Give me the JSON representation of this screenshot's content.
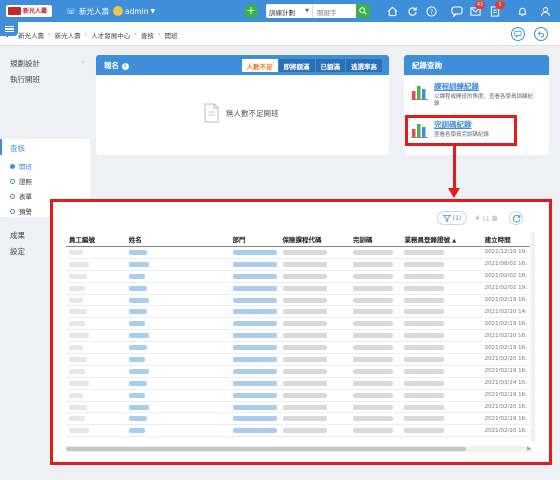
{
  "brand": {
    "logo_text": "新光人壽",
    "accent": "#3f8ed9",
    "highlight": "#e31b1b"
  },
  "topbar": {
    "company_label": "新光人壽",
    "user_label": "admin",
    "search_select_value": "訓練計劃",
    "search_placeholder": "關鍵字",
    "badge_inbox": "42",
    "badge_tasks": "1"
  },
  "breadcrumb": [
    "新光人壽",
    "新光人壽",
    "人才發展中心",
    "查核",
    "開班"
  ],
  "sidebar": {
    "items": [
      "規劃設計",
      "執行開班",
      "查核",
      "成果",
      "設定"
    ],
    "subitems": [
      "開班",
      "證照",
      "表單",
      "預警"
    ]
  },
  "enroll_card": {
    "title": "報名",
    "tabs": [
      "人數不足",
      "即將額滿",
      "已額滿",
      "逃選率高"
    ],
    "empty_text": "無人數不足開班"
  },
  "records_card": {
    "title": "紀錄查詢",
    "items": [
      {
        "title": "課程訓練紀錄",
        "desc": "以課程或開班的角度，查看各學員訓練紀錄"
      },
      {
        "title": "完訓碼紀錄",
        "desc": "查看各學員完訓碼紀錄"
      }
    ]
  },
  "table": {
    "filter_label": "(1)",
    "count_label": "11 筆",
    "headers": [
      "員工編號",
      "姓名",
      "部門",
      "保險課程代碼",
      "完訓碼",
      "業務員登錄證號",
      "建立時間"
    ],
    "dates": [
      "2021/12/10 19:",
      "2021/08/02 16:",
      "2021/02/02 18:",
      "2021/02/02 19:",
      "2021/02/19 16:",
      "2021/02/20 14:",
      "2021/02/19 16:",
      "2021/02/20 16:",
      "2021/02/19 16:",
      "2021/02/20 16:",
      "2021/02/19 16:",
      "2021/03/24 15:",
      "2021/02/19 16:",
      "2021/02/20 16:",
      "2021/02/19 16:",
      "2021/02/20 16:"
    ]
  },
  "icons": [
    "home-icon",
    "reload-icon",
    "help-icon",
    "chat-icon",
    "inbox-icon",
    "task-icon",
    "bell-icon",
    "user-icon",
    "filter-icon",
    "refresh-icon"
  ]
}
